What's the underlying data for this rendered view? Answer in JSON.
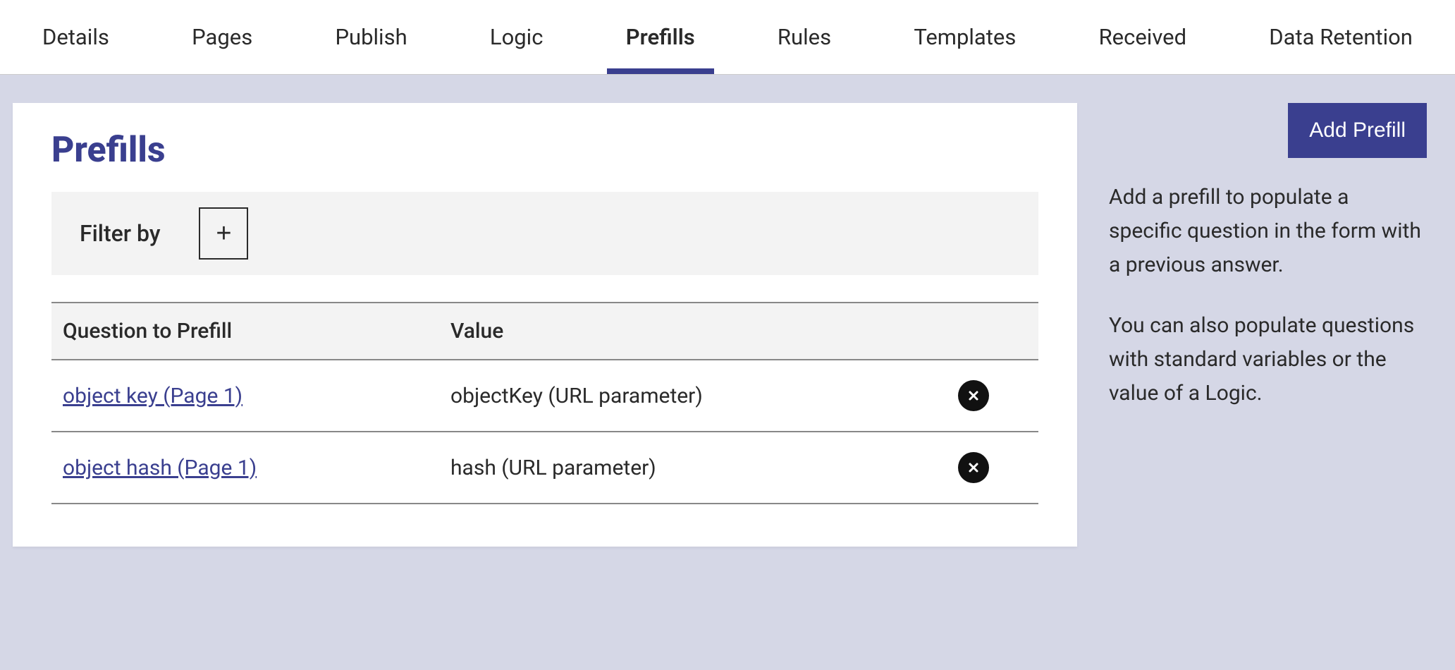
{
  "nav": {
    "tabs": [
      {
        "label": "Details"
      },
      {
        "label": "Pages"
      },
      {
        "label": "Publish"
      },
      {
        "label": "Logic"
      },
      {
        "label": "Prefills"
      },
      {
        "label": "Rules"
      },
      {
        "label": "Templates"
      },
      {
        "label": "Received"
      },
      {
        "label": "Data Retention"
      }
    ],
    "active_index": 4
  },
  "main": {
    "title": "Prefills",
    "filter_label": "Filter by",
    "table": {
      "headers": {
        "question": "Question to Prefill",
        "value": "Value"
      },
      "rows": [
        {
          "question": "object key (Page 1)",
          "value": "objectKey (URL parameter)"
        },
        {
          "question": "object hash (Page 1)",
          "value": "hash (URL parameter)"
        }
      ]
    }
  },
  "side": {
    "add_button": "Add Prefill",
    "para1": "Add a prefill to populate a specific question in the form with a previous answer.",
    "para2": "You can also populate questions with standard variables or the value of a Logic."
  }
}
